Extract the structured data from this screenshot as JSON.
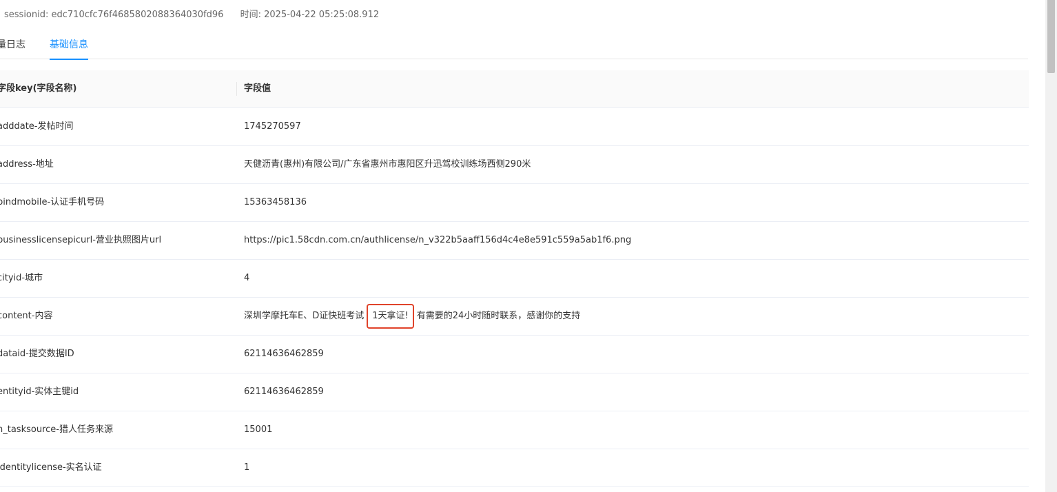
{
  "meta": {
    "session_label": "sessionid:",
    "session_value": "edc710cfc76f4685802088364030fd96",
    "time_label": "时间:",
    "time_value": "2025-04-22 05:25:08.912"
  },
  "tabs": {
    "log_label": "量日志",
    "basic_label": "基础信息"
  },
  "table": {
    "header_key": "字段key(字段名称)",
    "header_value": "字段值",
    "rows": [
      {
        "key": "adddate-发帖时间",
        "value": "1745270597"
      },
      {
        "key": "address-地址",
        "value": "天健沥青(惠州)有限公司/广东省惠州市惠阳区升迅驾校训练场西侧290米"
      },
      {
        "key": "bindmobile-认证手机号码",
        "value": "15363458136"
      },
      {
        "key": "businesslicensepicurl-营业执照图片url",
        "value": "https://pic1.58cdn.com.cn/authlicense/n_v322b5aaff156d4c4e8e591c559a5ab1f6.png"
      },
      {
        "key": "cityid-城市",
        "value": "4"
      },
      {
        "key": "content-内容",
        "value_before": "深圳学摩托车E、D证快班考试",
        "value_highlight": "1天拿证!",
        "value_after": "有需要的24小时随时联系，感谢你的支持"
      },
      {
        "key": "dataid-提交数据ID",
        "value": "62114636462859"
      },
      {
        "key": "entityid-实体主键id",
        "value": "62114636462859"
      },
      {
        "key": "h_tasksource-猎人任务来源",
        "value": "15001"
      },
      {
        "key": "identitylicense-实名认证",
        "value": "1"
      }
    ]
  }
}
